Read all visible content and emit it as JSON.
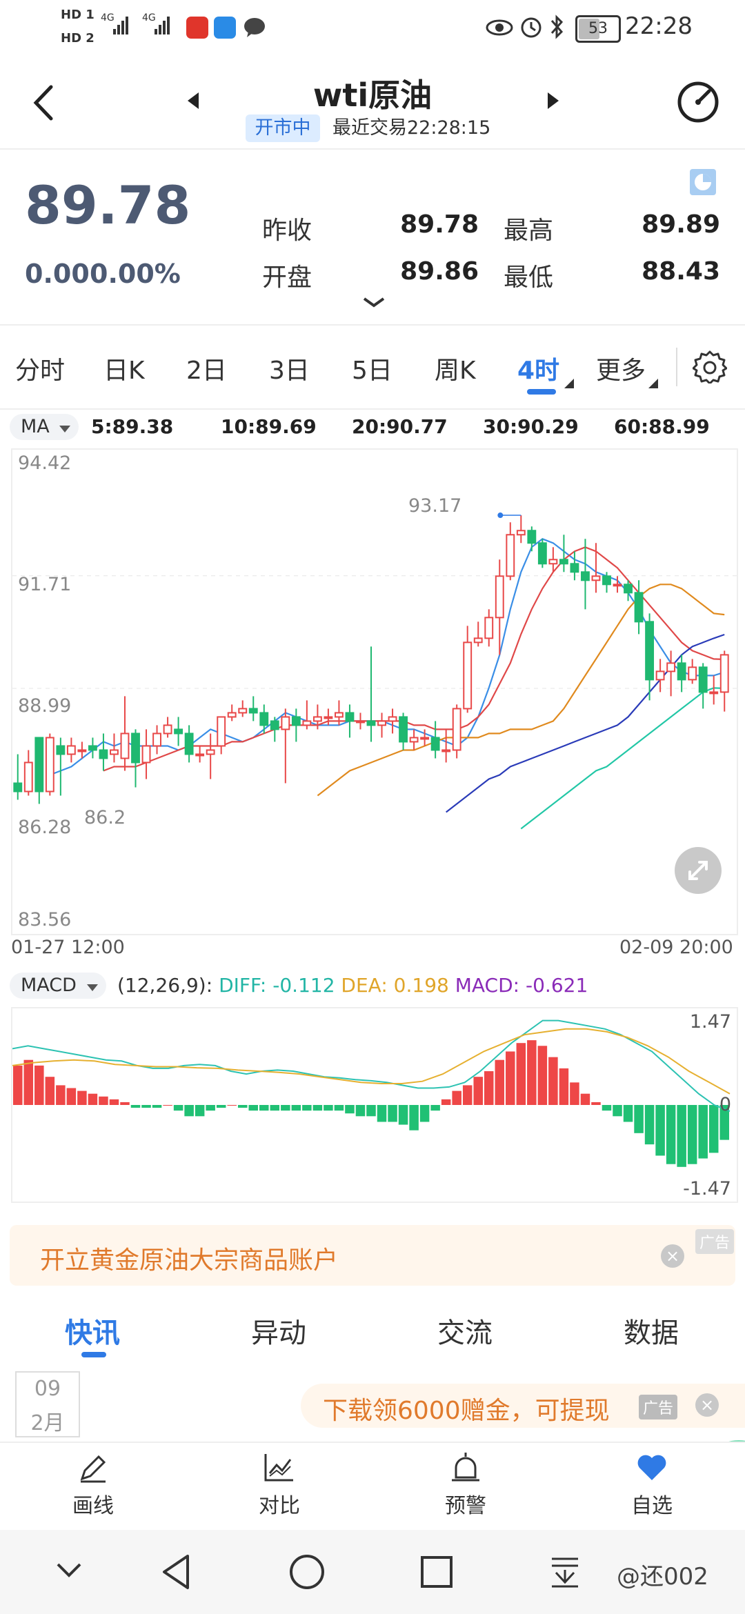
{
  "status_bar": {
    "sim1": "HD 1",
    "sim2": "HD 2",
    "net1": "4G",
    "net2": "4G",
    "battery": "53",
    "time": "22:28"
  },
  "header": {
    "title": "wti原油",
    "market_status": "开市中",
    "last_trade": "最近交易22:28:15"
  },
  "quote": {
    "price": "89.78",
    "change": "0.00",
    "change_pct": "0.00%",
    "prev_close_label": "昨收",
    "prev_close": "89.78",
    "high_label": "最高",
    "high": "89.89",
    "open_label": "开盘",
    "open": "89.86",
    "low_label": "最低",
    "low": "88.43"
  },
  "tabs": [
    "分时",
    "日K",
    "2日",
    "3日",
    "5日",
    "周K",
    "4时",
    "更多"
  ],
  "active_tab": "4时",
  "ma_legend": {
    "selector": "MA",
    "items": [
      {
        "label": "5:89.38",
        "color": "#3a8ee6"
      },
      {
        "label": "10:89.69",
        "color": "#e04848"
      },
      {
        "label": "20:90.77",
        "color": "#e08a1e"
      },
      {
        "label": "30:90.29",
        "color": "#2a3bb8"
      },
      {
        "label": "60:88.99",
        "color": "#22c7a6"
      }
    ]
  },
  "kline": {
    "y_labels": [
      "94.42",
      "91.71",
      "88.99",
      "86.28",
      "83.56"
    ],
    "x_start": "01-27 12:00",
    "x_end": "02-09 20:00",
    "max_marker": "93.17",
    "min_marker": "86.2"
  },
  "macd_legend": {
    "selector": "MACD",
    "params": "(12,26,9):",
    "diff": "DIFF: -0.112",
    "dea": "DEA: 0.198",
    "macd": "MACD: -0.621"
  },
  "macd_axis": {
    "top": "1.47",
    "zero": "0",
    "bottom": "-1.47"
  },
  "ad_banner": {
    "text": "开立黄金原油大宗商品账户",
    "tag": "广告"
  },
  "news_tabs": [
    "快讯",
    "异动",
    "交流",
    "数据"
  ],
  "date_box": {
    "day": "09",
    "month": "2月"
  },
  "ad_banner2": {
    "text": "下载领6000赠金，可提现",
    "tag": "广告"
  },
  "toolbar": [
    {
      "label": "画线",
      "icon": "pen-icon"
    },
    {
      "label": "对比",
      "icon": "chart-compare-icon"
    },
    {
      "label": "预警",
      "icon": "alarm-icon"
    },
    {
      "label": "自选",
      "icon": "heart-icon"
    }
  ],
  "watermark": "@还002",
  "chart_data": {
    "type": "candlestick",
    "title": "wti原油",
    "xlabel": "",
    "ylabel": "",
    "ylim": [
      83.56,
      94.42
    ],
    "x_range": [
      "01-27 12:00",
      "02-09 20:00"
    ],
    "candles": [
      [
        86.7,
        86.5,
        87.4,
        86.3
      ],
      [
        86.5,
        87.2,
        87.5,
        86.4
      ],
      [
        87.8,
        86.5,
        87.8,
        86.2
      ],
      [
        86.5,
        87.8,
        87.9,
        86.4
      ],
      [
        87.6,
        87.4,
        87.8,
        86.4
      ],
      [
        87.4,
        87.6,
        87.8,
        87.2
      ],
      [
        87.5,
        87.5,
        87.7,
        87.3
      ],
      [
        87.6,
        87.5,
        87.8,
        87.3
      ],
      [
        87.5,
        87.3,
        87.9,
        87.0
      ],
      [
        87.4,
        87.5,
        87.9,
        87.2
      ],
      [
        87.3,
        87.9,
        88.8,
        87.0
      ],
      [
        87.9,
        87.2,
        88.0,
        86.6
      ],
      [
        87.2,
        87.6,
        88.0,
        86.8
      ],
      [
        87.6,
        87.9,
        88.1,
        87.4
      ],
      [
        87.9,
        88.1,
        88.3,
        87.8
      ],
      [
        88.0,
        87.9,
        88.3,
        87.6
      ],
      [
        87.9,
        87.4,
        88.1,
        87.2
      ],
      [
        87.4,
        87.4,
        87.6,
        87.2
      ],
      [
        87.4,
        87.5,
        87.9,
        86.8
      ],
      [
        87.6,
        88.3,
        88.3,
        87.4
      ],
      [
        88.3,
        88.4,
        88.6,
        88.2
      ],
      [
        88.4,
        88.5,
        88.7,
        88.3
      ],
      [
        88.5,
        88.4,
        88.8,
        88.2
      ],
      [
        88.4,
        88.1,
        88.6,
        87.9
      ],
      [
        88.2,
        88.0,
        88.3,
        87.7
      ],
      [
        88.0,
        88.3,
        88.5,
        86.7
      ],
      [
        88.3,
        88.1,
        88.5,
        87.7
      ],
      [
        88.1,
        88.2,
        88.7,
        88.0
      ],
      [
        88.2,
        88.3,
        88.6,
        88.0
      ],
      [
        88.3,
        88.3,
        88.5,
        88.1
      ],
      [
        88.3,
        88.4,
        88.7,
        88.1
      ],
      [
        88.4,
        88.2,
        88.6,
        87.8
      ],
      [
        88.2,
        88.2,
        88.4,
        88.0
      ],
      [
        88.2,
        88.1,
        90.0,
        87.7
      ],
      [
        88.1,
        88.2,
        88.4,
        87.8
      ],
      [
        88.2,
        88.3,
        88.5,
        87.9
      ],
      [
        88.3,
        87.7,
        88.4,
        87.5
      ],
      [
        87.7,
        87.8,
        88.0,
        87.5
      ],
      [
        87.8,
        87.8,
        88.0,
        87.6
      ],
      [
        87.8,
        87.5,
        88.2,
        87.3
      ],
      [
        87.5,
        87.5,
        88.0,
        87.2
      ],
      [
        87.5,
        88.5,
        88.6,
        87.3
      ],
      [
        88.5,
        90.1,
        90.5,
        88.4
      ],
      [
        90.1,
        90.2,
        90.6,
        90.0
      ],
      [
        90.2,
        90.7,
        90.9,
        90.0
      ],
      [
        90.7,
        91.7,
        92.1,
        89.8
      ],
      [
        91.7,
        92.7,
        93.0,
        91.6
      ],
      [
        92.7,
        92.8,
        93.17,
        92.5
      ],
      [
        92.8,
        92.5,
        92.9,
        92.3
      ],
      [
        92.5,
        92.0,
        92.6,
        91.9
      ],
      [
        92.0,
        92.1,
        92.4,
        91.8
      ],
      [
        92.1,
        92.0,
        92.7,
        91.8
      ],
      [
        92.0,
        91.8,
        92.3,
        91.6
      ],
      [
        91.8,
        91.6,
        92.6,
        90.9
      ],
      [
        91.6,
        91.7,
        92.5,
        91.3
      ],
      [
        91.7,
        91.5,
        91.8,
        91.3
      ],
      [
        91.5,
        91.5,
        91.7,
        91.3
      ],
      [
        91.5,
        91.3,
        91.6,
        91.1
      ],
      [
        91.3,
        90.6,
        91.6,
        90.3
      ],
      [
        90.6,
        89.2,
        90.8,
        88.7
      ],
      [
        89.2,
        89.4,
        89.7,
        88.9
      ],
      [
        89.4,
        89.6,
        89.9,
        88.8
      ],
      [
        89.6,
        89.2,
        89.8,
        88.9
      ],
      [
        89.2,
        89.5,
        89.7,
        89.1
      ],
      [
        89.5,
        88.9,
        89.6,
        88.5
      ],
      [
        88.9,
        88.9,
        89.3,
        88.6
      ],
      [
        88.9,
        89.8,
        89.9,
        88.43
      ]
    ],
    "series": [
      {
        "name": "MA5",
        "values": [
          86.9,
          87.0,
          87.1,
          87.3,
          87.5,
          87.7,
          87.6,
          87.7,
          87.6,
          87.6,
          87.6,
          87.6,
          87.5,
          87.6,
          87.8,
          88.0,
          87.9,
          87.8,
          87.7,
          87.8,
          88.0,
          88.2,
          88.4,
          88.3,
          88.2,
          88.1,
          88.1,
          88.1,
          88.2,
          88.2,
          88.2,
          88.2,
          88.1,
          88.0,
          88.0,
          87.9,
          87.8,
          87.7,
          87.6,
          87.8,
          88.3,
          89.0,
          89.8,
          90.9,
          91.8,
          92.4,
          92.6,
          92.5,
          92.3,
          92.1,
          92.0,
          91.8,
          91.7,
          91.6,
          91.3,
          90.9,
          90.4,
          90.0,
          89.6,
          89.4,
          89.3,
          89.3,
          89.3,
          89.38
        ]
      },
      {
        "name": "MA10",
        "values": [
          87.0,
          87.1,
          87.1,
          87.1,
          87.2,
          87.3,
          87.4,
          87.5,
          87.6,
          87.6,
          87.6,
          87.6,
          87.7,
          87.7,
          87.8,
          87.9,
          88.0,
          88.1,
          88.1,
          88.1,
          88.1,
          88.2,
          88.2,
          88.2,
          88.2,
          88.2,
          88.2,
          88.2,
          88.2,
          88.1,
          88.1,
          88.0,
          88.0,
          88.0,
          88.1,
          88.3,
          88.6,
          89.1,
          89.6,
          90.3,
          90.9,
          91.4,
          91.8,
          92.1,
          92.3,
          92.4,
          92.3,
          92.1,
          91.9,
          91.6,
          91.3,
          91.0,
          90.7,
          90.4,
          90.1,
          89.9,
          89.8,
          89.7,
          89.69
        ]
      },
      {
        "name": "MA20",
        "values": [
          86.4,
          86.6,
          86.8,
          87.0,
          87.1,
          87.2,
          87.3,
          87.4,
          87.5,
          87.5,
          87.6,
          87.7,
          87.8,
          87.8,
          87.8,
          87.8,
          87.9,
          87.9,
          88.0,
          88.0,
          88.0,
          88.1,
          88.2,
          88.5,
          88.9,
          89.3,
          89.7,
          90.1,
          90.5,
          90.9,
          91.2,
          91.4,
          91.5,
          91.5,
          91.4,
          91.2,
          91.0,
          90.8,
          90.77
        ]
      },
      {
        "name": "MA30",
        "values": [
          86.0,
          86.2,
          86.4,
          86.6,
          86.8,
          86.9,
          87.1,
          87.2,
          87.3,
          87.4,
          87.5,
          87.6,
          87.7,
          87.8,
          87.9,
          88.0,
          88.1,
          88.3,
          88.6,
          88.9,
          89.2,
          89.5,
          89.8,
          90.0,
          90.1,
          90.2,
          90.29
        ]
      },
      {
        "name": "MA60",
        "values": [
          85.6,
          85.8,
          86.0,
          86.2,
          86.4,
          86.6,
          86.8,
          87.0,
          87.1,
          87.3,
          87.5,
          87.7,
          87.9,
          88.1,
          88.3,
          88.5,
          88.7,
          88.9,
          89.0,
          88.99
        ]
      }
    ],
    "macd": {
      "diff": -0.112,
      "dea": 0.198,
      "macd": -0.621,
      "ylim": [
        -1.47,
        1.47
      ],
      "histogram": [
        0.7,
        0.8,
        0.7,
        0.5,
        0.35,
        0.3,
        0.25,
        0.2,
        0.15,
        0.1,
        0.05,
        -0.05,
        -0.05,
        -0.05,
        0.0,
        -0.1,
        -0.2,
        -0.2,
        -0.1,
        -0.05,
        0.0,
        -0.05,
        -0.1,
        -0.1,
        -0.1,
        -0.1,
        -0.1,
        -0.1,
        -0.1,
        -0.1,
        -0.1,
        -0.15,
        -0.2,
        -0.2,
        -0.3,
        -0.3,
        -0.35,
        -0.45,
        -0.3,
        -0.1,
        0.1,
        0.25,
        0.35,
        0.5,
        0.6,
        0.8,
        0.95,
        1.1,
        1.15,
        1.05,
        0.85,
        0.65,
        0.4,
        0.2,
        0.05,
        -0.1,
        -0.2,
        -0.3,
        -0.5,
        -0.7,
        -0.9,
        -1.05,
        -1.1,
        -1.05,
        -0.95,
        -0.85,
        -0.62
      ],
      "diff_line": [
        1.0,
        1.05,
        1.0,
        0.95,
        0.9,
        0.85,
        0.8,
        0.78,
        0.7,
        0.65,
        0.65,
        0.7,
        0.72,
        0.7,
        0.6,
        0.55,
        0.6,
        0.62,
        0.6,
        0.55,
        0.5,
        0.48,
        0.45,
        0.43,
        0.4,
        0.35,
        0.3,
        0.3,
        0.32,
        0.4,
        0.6,
        0.85,
        1.1,
        1.3,
        1.5,
        1.5,
        1.45,
        1.4,
        1.35,
        1.25,
        1.1,
        0.95,
        0.7,
        0.45,
        0.2,
        0.0,
        -0.112
      ],
      "dea_line": [
        0.7,
        0.75,
        0.78,
        0.8,
        0.78,
        0.72,
        0.7,
        0.68,
        0.68,
        0.66,
        0.65,
        0.62,
        0.6,
        0.58,
        0.55,
        0.5,
        0.45,
        0.4,
        0.38,
        0.38,
        0.42,
        0.55,
        0.75,
        0.95,
        1.1,
        1.25,
        1.3,
        1.35,
        1.35,
        1.3,
        1.2,
        1.05,
        0.85,
        0.6,
        0.4,
        0.198
      ]
    }
  }
}
